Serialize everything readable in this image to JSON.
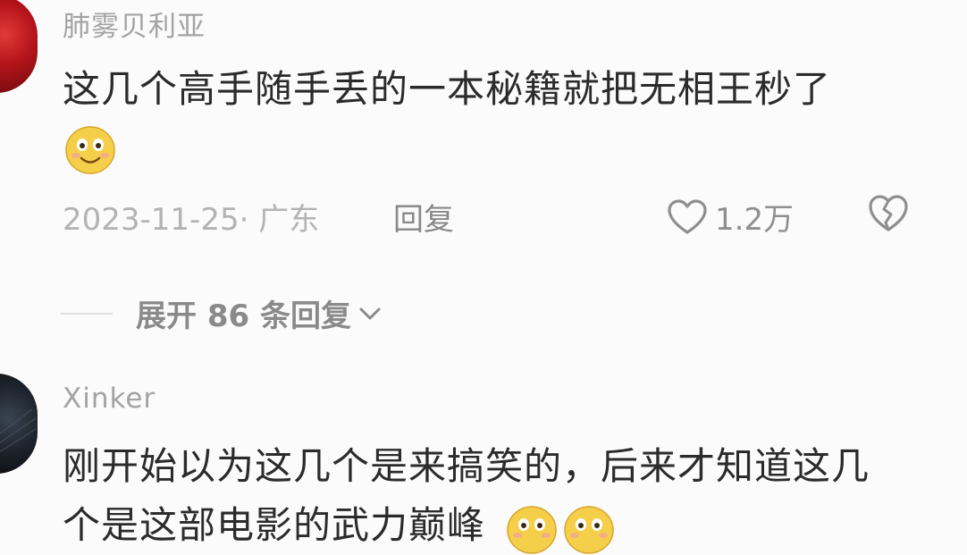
{
  "comments": [
    {
      "username": "肺雾贝利亚",
      "text": "这几个高手随手丢的一本秘籍就把无相王秒了",
      "date_location": "2023-11-25· 广东",
      "reply_label": "回复",
      "likes": "1.2万",
      "expand_replies": "展开 86 条回复",
      "emoji": "smiling-face"
    },
    {
      "username": "Xinker",
      "text_line1": "刚开始以为这几个是来搞笑的，后来才知道这几",
      "text_line2": "个是这部电影的武力巅峰",
      "emoji": "smiling-face"
    }
  ],
  "colors": {
    "background": "#fbfbfb",
    "username": "#a3a3a3",
    "body_text": "#2b2b2b",
    "meta": "#b3b3b3"
  }
}
